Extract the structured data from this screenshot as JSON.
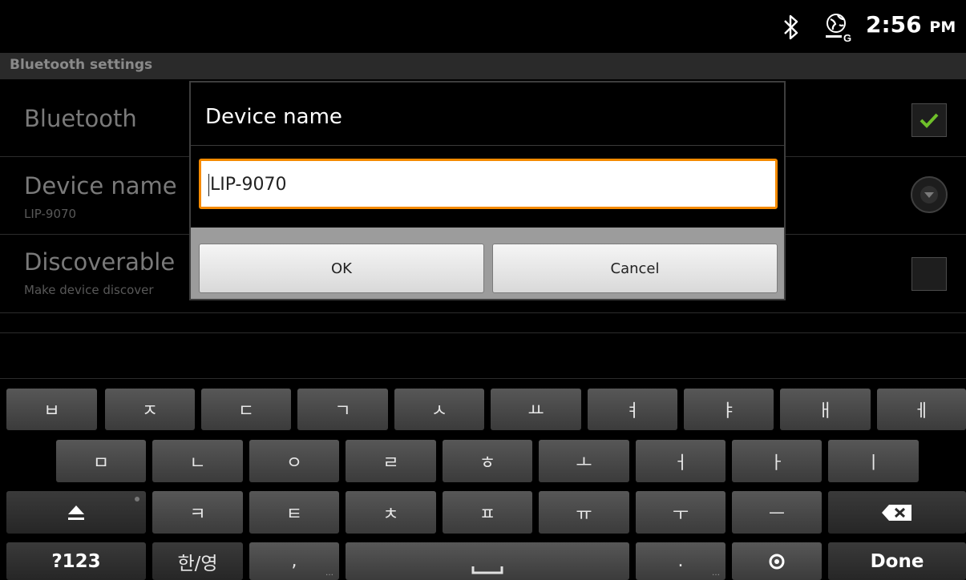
{
  "status_bar": {
    "bluetooth_icon": "bluetooth-icon",
    "network_icon": "network-globe-g-icon",
    "time": "2:56",
    "time_suffix": "PM"
  },
  "screen": {
    "title": "Bluetooth settings"
  },
  "settings": [
    {
      "title": "Bluetooth",
      "summary": "",
      "control": "checkbox",
      "checked": true
    },
    {
      "title": "Device name",
      "summary": "LIP-9070",
      "control": "dropdown"
    },
    {
      "title": "Discoverable",
      "summary": "Make device discover",
      "control": "checkbox",
      "checked": false
    }
  ],
  "dialog": {
    "title": "Device name",
    "input_value": "LIP-9070",
    "ok_label": "OK",
    "cancel_label": "Cancel"
  },
  "keyboard": {
    "row1": [
      "ㅂ",
      "ㅈ",
      "ㄷ",
      "ㄱ",
      "ㅅ",
      "ㅛ",
      "ㅕ",
      "ㅑ",
      "ㅐ",
      "ㅔ"
    ],
    "row2": [
      "ㅁ",
      "ㄴ",
      "ㅇ",
      "ㄹ",
      "ㅎ",
      "ㅗ",
      "ㅓ",
      "ㅏ",
      "ㅣ"
    ],
    "row3": [
      "ㅋ",
      "ㅌ",
      "ㅊ",
      "ㅍ",
      "ㅠ",
      "ㅜ",
      "ㅡ"
    ],
    "shift_icon": "shift-arrow-icon",
    "backspace_icon": "backspace-icon",
    "symbols_label": "?123",
    "lang_label": "한/영",
    "comma_label": ",",
    "space_icon": "space-icon",
    "period_label": ".",
    "settings_icon": "settings-dot-icon",
    "done_label": "Done"
  },
  "colors": {
    "accent_focus": "#f58a00",
    "checkmark_green": "#6fbf2a"
  }
}
